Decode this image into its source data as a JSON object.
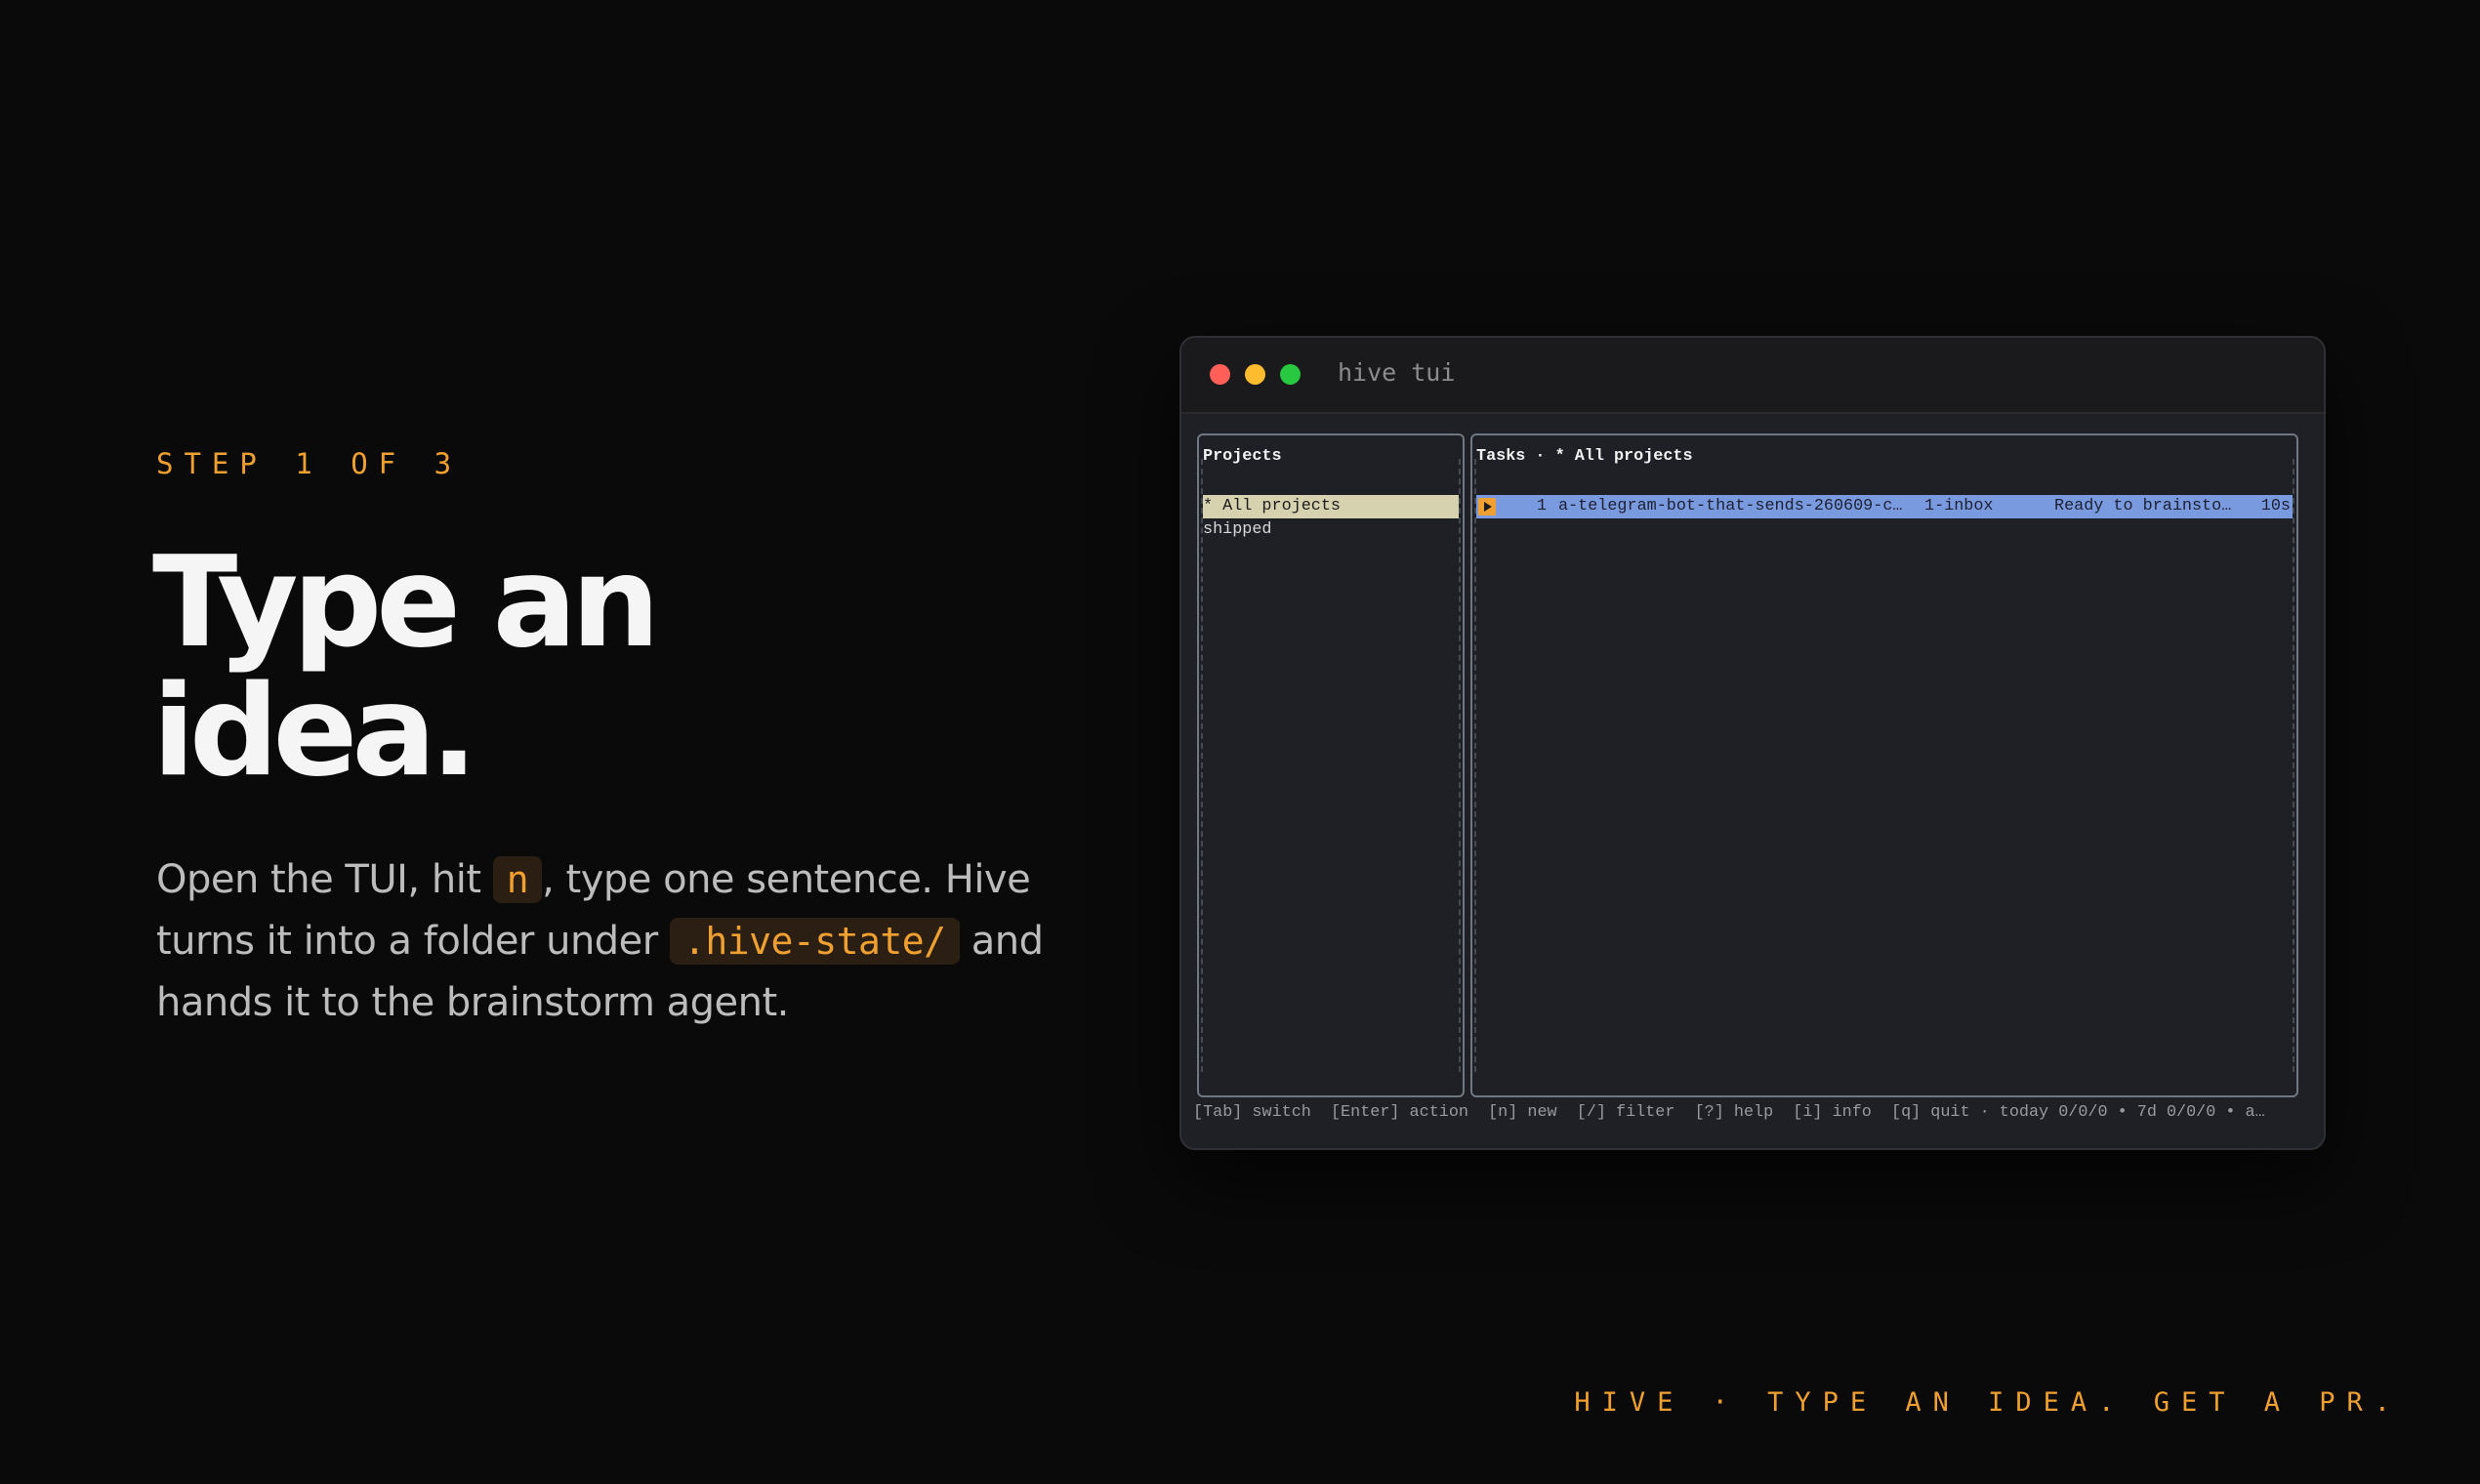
{
  "hero": {
    "step": "STEP 1 OF 3",
    "headline_line1": "Type an",
    "headline_line2": "idea.",
    "lead_part1": "Open the TUI, hit ",
    "lead_key": "n",
    "lead_part2": ", type one sentence. Hive turns it into a folder under ",
    "lead_path": ".hive-state/",
    "lead_part3": " and hands it to the brainstorm agent."
  },
  "window": {
    "title": "hive tui"
  },
  "projects": {
    "title": "Projects",
    "items": [
      {
        "label": "* All projects",
        "selected": true
      },
      {
        "label": "shipped",
        "selected": false
      }
    ]
  },
  "tasks": {
    "title": "Tasks · * All projects",
    "rows": [
      {
        "num": "1",
        "name": "a-telegram-bot-that-sends-260609-c…",
        "stage": "1-inbox",
        "status": "Ready to brainsto…",
        "age": "10s"
      }
    ]
  },
  "statusbar": {
    "text": "[Tab] switch  [Enter] action  [n] new  [/] filter  [?] help  [i] info  [q] quit · today 0/0/0 • 7d 0/0/0 • a…"
  },
  "footer": {
    "tag": "HIVE · TYPE AN IDEA. GET A PR."
  },
  "colors": {
    "accent": "#f0a030",
    "background": "#0a0a0a",
    "selected_project": "#d6d2b0",
    "selected_task": "#7a9ae0"
  },
  "icons": {
    "task_marker": "play-icon",
    "window_controls": [
      "close-dot",
      "minimize-dot",
      "maximize-dot"
    ]
  }
}
